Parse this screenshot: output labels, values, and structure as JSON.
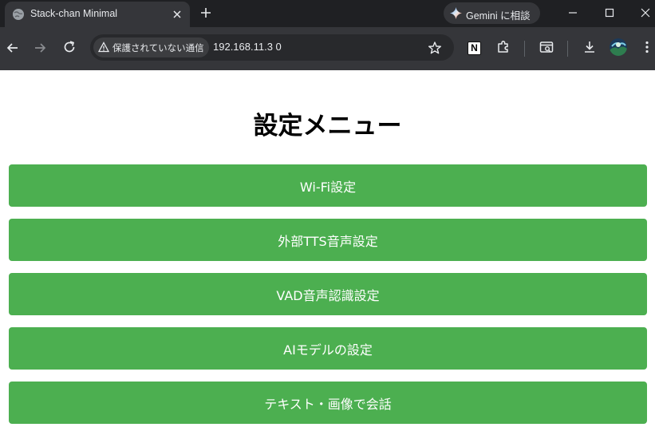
{
  "browser": {
    "tab": {
      "title": "Stack-chan Minimal"
    },
    "gemini_label": "Gemini に相談",
    "address": {
      "security_label": "保護されていない通信",
      "url": "192.168.11.3 0"
    },
    "extension_letter": "N"
  },
  "page": {
    "title": "設定メニュー",
    "menu": [
      {
        "label": "Wi-Fi設定"
      },
      {
        "label": "外部TTS音声設定"
      },
      {
        "label": "VAD音声認識設定"
      },
      {
        "label": "AIモデルの設定"
      },
      {
        "label": "テキスト・画像で会話"
      }
    ]
  },
  "colors": {
    "button_bg": "#4caf50",
    "button_text": "#ffffff",
    "chrome_dark": "#1f2023",
    "toolbar": "#35363a"
  }
}
